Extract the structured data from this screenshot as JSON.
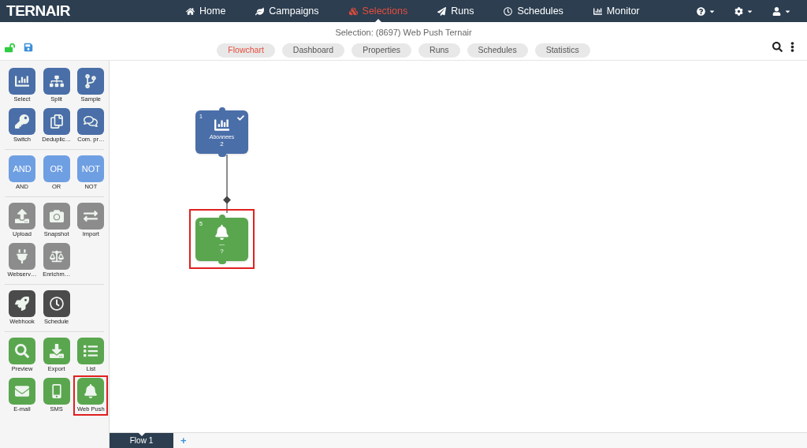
{
  "logo": "TERNAIR",
  "nav": [
    {
      "label": "Home",
      "selected": false
    },
    {
      "label": "Campaigns",
      "selected": false
    },
    {
      "label": "Selections",
      "selected": true
    },
    {
      "label": "Runs",
      "selected": false
    },
    {
      "label": "Schedules",
      "selected": false
    },
    {
      "label": "Monitor",
      "selected": false
    }
  ],
  "subheader": {
    "title": "Selection: (8697) Web Push Ternair",
    "unlocked": true
  },
  "tabs": [
    {
      "label": "Flowchart",
      "selected": true
    },
    {
      "label": "Dashboard",
      "selected": false
    },
    {
      "label": "Properties",
      "selected": false
    },
    {
      "label": "Runs",
      "selected": false
    },
    {
      "label": "Schedules",
      "selected": false
    },
    {
      "label": "Statistics",
      "selected": false
    }
  ],
  "palette": [
    {
      "color": "#4a6ea8",
      "tools": [
        {
          "label": "Select",
          "kind": "icon",
          "highlighted": false
        },
        {
          "label": "Split",
          "kind": "icon",
          "highlighted": false
        },
        {
          "label": "Sample",
          "kind": "icon",
          "highlighted": false
        },
        {
          "label": "Switch",
          "kind": "icon",
          "highlighted": false
        },
        {
          "label": "Deduplic…",
          "kind": "icon",
          "highlighted": false
        },
        {
          "label": "Com. pr…",
          "kind": "icon",
          "highlighted": false
        }
      ]
    },
    {
      "color": "#6f9fe3",
      "tools": [
        {
          "label": "AND",
          "text": "AND",
          "kind": "text",
          "highlighted": false
        },
        {
          "label": "OR",
          "text": "OR",
          "kind": "text",
          "highlighted": false
        },
        {
          "label": "NOT",
          "text": "NOT",
          "kind": "text",
          "highlighted": false
        }
      ]
    },
    {
      "color": "#8c8c8c",
      "tools": [
        {
          "label": "Upload",
          "kind": "icon",
          "highlighted": false
        },
        {
          "label": "Snapshot",
          "kind": "icon",
          "highlighted": false
        },
        {
          "label": "Import",
          "kind": "icon",
          "highlighted": false
        },
        {
          "label": "Webserv…",
          "kind": "icon",
          "highlighted": false
        },
        {
          "label": "Enrichm…",
          "kind": "icon",
          "highlighted": false
        }
      ]
    },
    {
      "color": "#4b4b4b",
      "tools": [
        {
          "label": "Webhook",
          "kind": "icon",
          "highlighted": false
        },
        {
          "label": "Schedule",
          "kind": "icon",
          "highlighted": false
        }
      ]
    },
    {
      "color": "#5aa64f",
      "tools": [
        {
          "label": "Preview",
          "kind": "icon",
          "highlighted": false
        },
        {
          "label": "Export",
          "kind": "icon",
          "highlighted": false
        },
        {
          "label": "List",
          "kind": "icon",
          "highlighted": false
        },
        {
          "label": "E-mail",
          "kind": "icon",
          "highlighted": false
        },
        {
          "label": "SMS",
          "kind": "icon",
          "highlighted": false
        },
        {
          "label": "Web Push",
          "kind": "icon",
          "highlighted": true
        }
      ]
    }
  ],
  "nodes": [
    {
      "number": "1",
      "name": "Abonnees",
      "count": "2",
      "color": "#4a6ea8",
      "checked": true,
      "highlighted": false
    },
    {
      "number": "5",
      "name": "—",
      "count": "?",
      "color": "#5aa64f",
      "checked": false,
      "highlighted": true
    }
  ],
  "flows": [
    {
      "label": "Flow 1",
      "selected": true
    }
  ],
  "add_flow": "+"
}
